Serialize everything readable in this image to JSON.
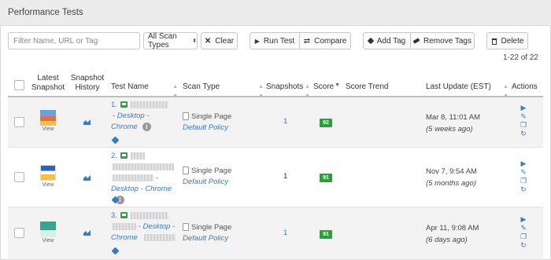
{
  "panel": {
    "title": "Performance Tests"
  },
  "toolbar": {
    "filter_placeholder": "Filter Name, URL or Tag",
    "scan_types_label": "All Scan Types",
    "clear_label": "Clear",
    "run_test_label": "Run Test",
    "compare_label": "Compare",
    "add_tag_label": "Add Tag",
    "remove_tags_label": "Remove Tags",
    "delete_label": "Delete"
  },
  "pagination": {
    "range": "1-22 of 22"
  },
  "columns": {
    "latest_snapshot_1": "Latest",
    "latest_snapshot_2": "Snapshot",
    "snapshot_history_1": "Snapshot",
    "snapshot_history_2": "History",
    "test_name": "Test Name",
    "scan_type": "Scan Type",
    "snapshots": "Snapshots",
    "score": "Score",
    "score_trend": "Score Trend",
    "last_update": "Last Update (EST)",
    "actions": "Actions"
  },
  "rows": [
    {
      "index": "1.",
      "view": "View",
      "device_a": "- Desktop -",
      "device_b": "Chrome",
      "scan_type": "Single Page",
      "policy": "Default Policy",
      "snapshots": "1",
      "score": "92",
      "update_date": "Mar 8, 11:01 AM",
      "update_rel": "(5 weeks ago)"
    },
    {
      "index": "2.",
      "view": "View",
      "device_a": "-",
      "device_b": "Desktop - Chrome",
      "scan_type": "Single Page",
      "policy": "Default Policy",
      "snapshots": "1",
      "score": "91",
      "update_date": "Nov 7, 9:54 AM",
      "update_rel": "(5 months ago)"
    },
    {
      "index": "3.",
      "view": "View",
      "device_a": "- Desktop -",
      "device_b": "Chrome",
      "scan_type": "Single Page",
      "policy": "Default Policy",
      "snapshots": "1",
      "score": "91",
      "update_date": "Apr 11, 9:08 AM",
      "update_rel": "(6 days ago)"
    }
  ],
  "colors": {
    "accent": "#3a7abf",
    "score_good": "#2e9e3c",
    "header_bg": "#ececec"
  },
  "icons": [
    "play-icon",
    "swap-icon",
    "tag-icon",
    "eraser-icon",
    "trash-icon",
    "close-icon",
    "chart-icon",
    "pencil-icon",
    "copy-icon",
    "refresh-icon",
    "info-icon",
    "monitor-icon",
    "document-icon"
  ]
}
